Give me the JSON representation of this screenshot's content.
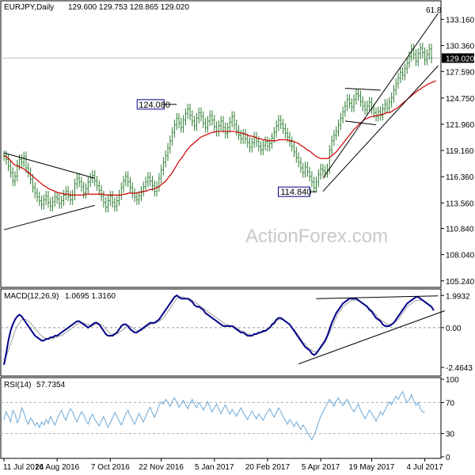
{
  "header": {
    "symbol_info": "EURJPY,Daily",
    "ohlc": "129.600 129.753 128.865 129.020"
  },
  "watermark": "ActionForex.com",
  "chart_data": [
    {
      "type": "candlestick",
      "panel": "price",
      "title": "EURJPY,Daily",
      "ylim": [
        104.8,
        134.8
      ],
      "y_ticks": [
        "133.160",
        "130.360",
        "127.590",
        "124.750",
        "121.960",
        "119.160",
        "116.360",
        "113.560",
        "110.840",
        "108.040",
        "105.240"
      ],
      "current_price_label": "129.020",
      "current_price": 129.02,
      "annotations": [
        {
          "text": "124.080",
          "value": 124.08
        },
        {
          "text": "114.840",
          "value": 114.84
        },
        {
          "text": "61.8",
          "value": 134.2
        }
      ],
      "moving_average_color": "#d00000",
      "bar_color": "#2e7d32",
      "close": [
        118.6,
        118.2,
        117.5,
        116.8,
        115.9,
        116.4,
        117.6,
        118.2,
        117.9,
        118.5,
        117.3,
        116.8,
        116.1,
        115.2,
        114.6,
        114.2,
        113.8,
        113.4,
        113.9,
        114.3,
        113.6,
        113.2,
        113.7,
        114.2,
        114.0,
        113.5,
        113.8,
        114.4,
        114.8,
        114.3,
        113.9,
        114.4,
        115.6,
        116.2,
        115.8,
        115.3,
        114.6,
        115.1,
        115.8,
        116.2,
        116.5,
        115.9,
        115.4,
        114.9,
        114.3,
        113.6,
        113.1,
        113.8,
        114.3,
        113.6,
        113.2,
        113.8,
        114.4,
        115.2,
        115.9,
        116.4,
        115.8,
        115.2,
        114.6,
        114.2,
        113.9,
        114.3,
        114.8,
        115.3,
        115.8,
        116.3,
        115.9,
        115.4,
        114.8,
        115.3,
        116.2,
        117.1,
        117.9,
        118.6,
        119.4,
        120.2,
        121.1,
        121.9,
        122.6,
        122.1,
        121.6,
        122.4,
        123.1,
        123.6,
        122.9,
        122.3,
        121.8,
        122.6,
        123.2,
        122.8,
        122.1,
        121.6,
        122.3,
        122.9,
        122.4,
        121.7,
        121.2,
        121.8,
        122.3,
        121.6,
        121.0,
        121.6,
        122.2,
        122.8,
        121.9,
        121.3,
        120.8,
        120.4,
        120.9,
        120.4,
        120.0,
        119.5,
        120.0,
        120.6,
        120.1,
        119.6,
        119.2,
        119.7,
        120.1,
        119.6,
        119.9,
        120.5,
        121.1,
        121.8,
        122.4,
        122.0,
        121.5,
        121.0,
        120.6,
        120.1,
        119.6,
        119.0,
        118.4,
        117.9,
        117.3,
        116.8,
        117.4,
        116.9,
        116.4,
        115.8,
        115.2,
        115.8,
        116.6,
        117.2,
        117.0,
        116.8,
        117.2,
        119.2,
        120.2,
        120.8,
        121.2,
        121.9,
        122.6,
        123.3,
        123.9,
        124.6,
        124.2,
        123.8,
        124.6,
        125.2,
        125.0,
        124.4,
        123.9,
        123.5,
        123.9,
        124.3,
        123.6,
        123.2,
        122.8,
        123.3,
        122.9,
        123.6,
        124.1,
        123.7,
        124.3,
        124.8,
        125.6,
        126.3,
        126.9,
        127.5,
        127.2,
        127.9,
        128.5,
        129.2,
        130.0,
        129.4,
        128.7,
        129.5,
        130.1,
        129.6,
        128.8,
        129.4,
        130.0,
        129.02
      ],
      "moving_average": [
        118.6,
        118.5,
        118.3,
        118.1,
        117.8,
        117.6,
        117.5,
        117.4,
        117.3,
        117.2,
        117.0,
        116.8,
        116.6,
        116.4,
        116.2,
        116.0,
        115.8,
        115.6,
        115.4,
        115.3,
        115.1,
        115.0,
        114.9,
        114.8,
        114.7,
        114.6,
        114.6,
        114.5,
        114.5,
        114.5,
        114.4,
        114.4,
        114.4,
        114.4,
        114.4,
        114.4,
        114.4,
        114.5,
        114.5,
        114.5,
        114.5,
        114.5,
        114.5,
        114.5,
        114.5,
        114.5,
        114.4,
        114.4,
        114.4,
        114.4,
        114.4,
        114.4,
        114.4,
        114.4,
        114.5,
        114.5,
        114.6,
        114.6,
        114.6,
        114.6,
        114.6,
        114.7,
        114.7,
        114.8,
        114.8,
        114.9,
        115.0,
        115.0,
        115.1,
        115.2,
        115.3,
        115.5,
        115.7,
        115.9,
        116.2,
        116.5,
        116.8,
        117.2,
        117.6,
        118.0,
        118.3,
        118.6,
        119.0,
        119.3,
        119.6,
        119.8,
        120.0,
        120.2,
        120.4,
        120.6,
        120.7,
        120.8,
        120.9,
        121.0,
        121.1,
        121.1,
        121.2,
        121.2,
        121.2,
        121.2,
        121.2,
        121.2,
        121.2,
        121.2,
        121.2,
        121.1,
        121.1,
        121.0,
        121.0,
        120.9,
        120.8,
        120.7,
        120.7,
        120.6,
        120.5,
        120.4,
        120.4,
        120.3,
        120.3,
        120.2,
        120.2,
        120.2,
        120.2,
        120.2,
        120.3,
        120.3,
        120.3,
        120.3,
        120.3,
        120.2,
        120.2,
        120.1,
        120.0,
        119.9,
        119.7,
        119.6,
        119.4,
        119.2,
        119.1,
        118.9,
        118.7,
        118.5,
        118.4,
        118.3,
        118.3,
        118.3,
        118.3,
        118.4,
        118.6,
        118.8,
        119.0,
        119.3,
        119.6,
        119.9,
        120.2,
        120.5,
        120.8,
        121.1,
        121.4,
        121.6,
        121.9,
        122.1,
        122.3,
        122.5,
        122.6,
        122.7,
        122.8,
        122.8,
        122.9,
        122.9,
        123.0,
        123.0,
        123.1,
        123.2,
        123.2,
        123.3,
        123.5,
        123.6,
        123.8,
        124.0,
        124.2,
        124.4,
        124.6,
        124.8,
        125.0,
        125.2,
        125.4,
        125.6,
        125.7,
        125.9,
        126.0,
        126.2,
        126.3,
        126.4,
        126.5,
        126.6
      ]
    },
    {
      "type": "line",
      "panel": "macd",
      "title": "MACD(12,26,9)",
      "header_values": "1.0695 1.3160",
      "ylim": [
        -2.9,
        2.3
      ],
      "y_ticks": [
        "1.9932",
        "0.00",
        "-2.4643"
      ],
      "series": [
        {
          "name": "MACD",
          "color": "#00008b",
          "values": [
            -2.3,
            -1.6,
            -0.8,
            -0.2,
            0.2,
            0.5,
            0.7,
            0.8,
            0.7,
            0.5,
            0.3,
            0.1,
            -0.1,
            -0.3,
            -0.5,
            -0.6,
            -0.7,
            -0.8,
            -0.8,
            -0.7,
            -0.7,
            -0.6,
            -0.6,
            -0.5,
            -0.5,
            -0.4,
            -0.3,
            -0.2,
            -0.1,
            0.0,
            0.1,
            0.2,
            0.3,
            0.4,
            0.4,
            0.3,
            0.2,
            0.1,
            0.0,
            0.1,
            0.2,
            0.3,
            0.3,
            0.2,
            0.0,
            -0.2,
            -0.4,
            -0.5,
            -0.5,
            -0.5,
            -0.4,
            -0.3,
            -0.1,
            0.1,
            0.2,
            0.2,
            0.1,
            -0.1,
            -0.2,
            -0.3,
            -0.3,
            -0.2,
            -0.1,
            0.0,
            0.1,
            0.2,
            0.3,
            0.3,
            0.3,
            0.4,
            0.5,
            0.7,
            0.9,
            1.1,
            1.3,
            1.5,
            1.7,
            1.9,
            2.0,
            1.9,
            1.8,
            1.8,
            1.8,
            1.8,
            1.7,
            1.6,
            1.4,
            1.3,
            1.3,
            1.2,
            1.1,
            0.9,
            0.8,
            0.7,
            0.6,
            0.5,
            0.4,
            0.3,
            0.2,
            0.1,
            0.1,
            0.1,
            0.1,
            0.1,
            0.0,
            -0.1,
            -0.2,
            -0.3,
            -0.3,
            -0.4,
            -0.5,
            -0.5,
            -0.5,
            -0.4,
            -0.4,
            -0.3,
            -0.3,
            -0.2,
            -0.2,
            -0.1,
            0.0,
            0.2,
            0.3,
            0.5,
            0.6,
            0.6,
            0.5,
            0.4,
            0.3,
            0.2,
            0.0,
            -0.2,
            -0.4,
            -0.6,
            -0.8,
            -1.0,
            -1.2,
            -1.3,
            -1.4,
            -1.6,
            -1.7,
            -1.6,
            -1.4,
            -1.2,
            -1.0,
            -0.8,
            -0.5,
            -0.1,
            0.3,
            0.6,
            0.9,
            1.1,
            1.3,
            1.5,
            1.6,
            1.7,
            1.8,
            1.8,
            1.8,
            1.8,
            1.7,
            1.6,
            1.5,
            1.4,
            1.3,
            1.1,
            1.0,
            0.8,
            0.6,
            0.5,
            0.4,
            0.2,
            0.1,
            0.1,
            0.1,
            0.2,
            0.3,
            0.5,
            0.7,
            0.9,
            1.1,
            1.3,
            1.5,
            1.6,
            1.7,
            1.8,
            1.9,
            1.9,
            1.8,
            1.7,
            1.6,
            1.5,
            1.4,
            1.3,
            1.07
          ]
        },
        {
          "name": "Signal",
          "color": "#a0a0a0",
          "values": [
            -2.0,
            -1.8,
            -1.4,
            -1.0,
            -0.6,
            -0.2,
            0.1,
            0.3,
            0.5,
            0.5,
            0.5,
            0.4,
            0.3,
            0.1,
            -0.1,
            -0.2,
            -0.4,
            -0.5,
            -0.6,
            -0.7,
            -0.7,
            -0.7,
            -0.7,
            -0.6,
            -0.6,
            -0.5,
            -0.5,
            -0.4,
            -0.3,
            -0.2,
            -0.1,
            0.0,
            0.1,
            0.2,
            0.3,
            0.3,
            0.3,
            0.2,
            0.2,
            0.1,
            0.1,
            0.2,
            0.2,
            0.2,
            0.2,
            0.1,
            -0.1,
            -0.2,
            -0.4,
            -0.4,
            -0.4,
            -0.4,
            -0.3,
            -0.2,
            -0.1,
            0.0,
            0.1,
            0.1,
            0.0,
            -0.1,
            -0.2,
            -0.2,
            -0.2,
            -0.1,
            0.0,
            0.1,
            0.2,
            0.2,
            0.3,
            0.3,
            0.4,
            0.5,
            0.6,
            0.8,
            1.0,
            1.2,
            1.4,
            1.6,
            1.8,
            1.9,
            1.9,
            1.9,
            1.8,
            1.8,
            1.8,
            1.7,
            1.6,
            1.5,
            1.4,
            1.3,
            1.2,
            1.1,
            1.0,
            0.9,
            0.8,
            0.7,
            0.6,
            0.5,
            0.4,
            0.3,
            0.2,
            0.2,
            0.1,
            0.1,
            0.1,
            0.0,
            -0.1,
            -0.2,
            -0.2,
            -0.3,
            -0.4,
            -0.4,
            -0.5,
            -0.4,
            -0.4,
            -0.4,
            -0.3,
            -0.3,
            -0.2,
            -0.1,
            0.0,
            0.1,
            0.2,
            0.4,
            0.5,
            0.5,
            0.5,
            0.4,
            0.3,
            0.2,
            0.0,
            -0.1,
            -0.3,
            -0.5,
            -0.7,
            -0.9,
            -1.0,
            -1.2,
            -1.3,
            -1.4,
            -1.5,
            -1.5,
            -1.4,
            -1.3,
            -1.1,
            -0.9,
            -0.6,
            -0.3,
            0.0,
            0.3,
            0.6,
            0.9,
            1.1,
            1.3,
            1.4,
            1.5,
            1.6,
            1.7,
            1.7,
            1.7,
            1.7,
            1.6,
            1.5,
            1.4,
            1.3,
            1.2,
            1.1,
            0.9,
            0.8,
            0.6,
            0.5,
            0.4,
            0.3,
            0.2,
            0.2,
            0.2,
            0.3,
            0.4,
            0.5,
            0.7,
            0.9,
            1.1,
            1.3,
            1.4,
            1.5,
            1.6,
            1.7,
            1.7,
            1.7,
            1.7,
            1.6,
            1.5,
            1.4,
            1.32
          ]
        }
      ]
    },
    {
      "type": "line",
      "panel": "rsi",
      "title": "RSI(14)",
      "header_values": "57.7354",
      "ylim": [
        0,
        100
      ],
      "y_ticks": [
        "100",
        "70",
        "30",
        "0"
      ],
      "levels": [
        70,
        30
      ],
      "series": [
        {
          "name": "RSI(14)",
          "color": "#6aa8d8",
          "values": [
            48,
            58,
            52,
            45,
            60,
            55,
            44,
            50,
            63,
            57,
            48,
            42,
            50,
            46,
            40,
            44,
            38,
            45,
            41,
            48,
            43,
            52,
            46,
            41,
            48,
            55,
            60,
            52,
            47,
            56,
            62,
            58,
            50,
            45,
            52,
            58,
            54,
            47,
            42,
            50,
            55,
            48,
            44,
            40,
            47,
            52,
            45,
            38,
            44,
            50,
            57,
            52,
            46,
            41,
            48,
            55,
            60,
            53,
            47,
            42,
            49,
            56,
            50,
            45,
            52,
            59,
            64,
            57,
            51,
            58,
            66,
            71,
            68,
            74,
            70,
            65,
            72,
            76,
            70,
            64,
            68,
            73,
            67,
            62,
            69,
            74,
            68,
            63,
            70,
            66,
            60,
            65,
            71,
            64,
            58,
            63,
            68,
            61,
            56,
            62,
            67,
            60,
            55,
            61,
            57,
            52,
            58,
            63,
            57,
            52,
            48,
            54,
            59,
            53,
            49,
            55,
            51,
            47,
            53,
            58,
            62,
            56,
            51,
            57,
            63,
            58,
            52,
            47,
            42,
            48,
            44,
            39,
            45,
            40,
            35,
            41,
            37,
            31,
            27,
            22,
            28,
            35,
            44,
            52,
            58,
            63,
            69,
            74,
            70,
            65,
            72,
            76,
            71,
            66,
            70,
            74,
            68,
            62,
            58,
            63,
            68,
            60,
            55,
            49,
            54,
            60,
            56,
            51,
            46,
            52,
            58,
            54,
            60,
            66,
            71,
            67,
            73,
            78,
            74,
            80,
            84,
            76,
            70,
            74,
            80,
            72,
            66,
            70,
            62,
            58,
            57.7
          ]
        }
      ]
    }
  ],
  "x_axis": {
    "labels": [
      "11 Jul 2016",
      "24 Aug 2016",
      "7 Oct 2016",
      "22 Nov 2016",
      "5 Jan 2017",
      "20 Feb 2017",
      "5 Apr 2017",
      "19 May 2017",
      "4 Jul 2017"
    ]
  },
  "colors": {
    "price_bars": "#2e7d32",
    "moving_average": "#d00000",
    "macd_line": "#00008b",
    "signal_line": "#a0a0a0",
    "rsi_line": "#6aa8d8",
    "annotation_border": "#00008b"
  }
}
